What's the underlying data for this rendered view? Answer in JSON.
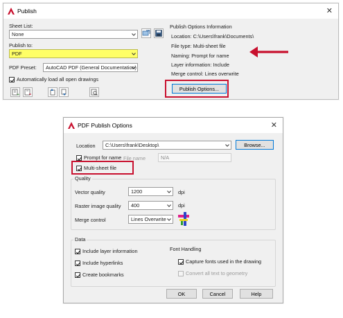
{
  "publish_dialog": {
    "title": "Publish",
    "close_glyph": "✕",
    "sheet_list_label": "Sheet List:",
    "sheet_list_value": "None",
    "publish_to_label": "Publish to:",
    "publish_to_value": "PDF",
    "pdf_preset_label": "PDF Preset:",
    "pdf_preset_value": "AutoCAD PDF (General Documentation)",
    "auto_load_label": "Automatically load all open drawings",
    "info_group_title": "Publish Options Information",
    "info_location": "Location: C:\\Users\\frank\\Documents\\",
    "info_file_type": "File type: Multi-sheet file",
    "info_naming": "Naming: Prompt for name",
    "info_layer": "Layer information: Include",
    "info_merge": "Merge control: Lines overwrite",
    "publish_options_button": "Publish Options...",
    "highlight_color": "#ffff66",
    "annotation_color": "#c8102e"
  },
  "pdf_options_dialog": {
    "title": "PDF Publish Options",
    "close_glyph": "✕",
    "location_label": "Location",
    "location_value": "C:\\Users\\frank\\Desktop\\",
    "browse_button": "Browse...",
    "prompt_for_name_label": "Prompt for name",
    "file_name_label": "File name",
    "file_name_value": "N/A",
    "multi_sheet_label": "Multi-sheet file",
    "quality_group_title": "Quality",
    "vector_quality_label": "Vector quality",
    "vector_quality_value": "1200",
    "raster_quality_label": "Raster image quality",
    "raster_quality_value": "400",
    "dpi_unit": "dpi",
    "merge_control_label": "Merge control",
    "merge_control_value": "Lines Overwrite",
    "data_group_title": "Data",
    "include_layer_label": "Include layer information",
    "include_hyperlinks_label": "Include hyperlinks",
    "create_bookmarks_label": "Create bookmarks",
    "font_handling_title": "Font Handling",
    "capture_fonts_label": "Capture fonts used in the drawing",
    "convert_text_label": "Convert all text to geometry",
    "ok_button": "OK",
    "cancel_button": "Cancel",
    "help_button": "Help"
  }
}
